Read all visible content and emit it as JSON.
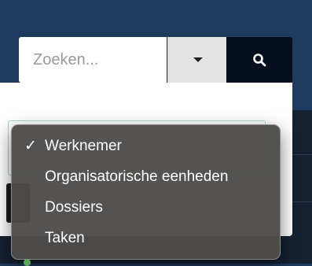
{
  "search": {
    "placeholder": "Zoeken...",
    "value": ""
  },
  "filter_menu": {
    "items": [
      {
        "label": "Werknemer",
        "selected": true
      },
      {
        "label": "Organisatorische eenheden",
        "selected": false
      },
      {
        "label": "Dossiers",
        "selected": false
      },
      {
        "label": "Taken",
        "selected": false
      }
    ]
  },
  "icons": {
    "dropdown": "chevron-down-icon",
    "search": "search-icon",
    "check": "checkmark-icon"
  },
  "colors": {
    "header_bg": "#1e3a5c",
    "search_button_bg": "#060e1d",
    "menu_bg": "#4e4c4a"
  }
}
